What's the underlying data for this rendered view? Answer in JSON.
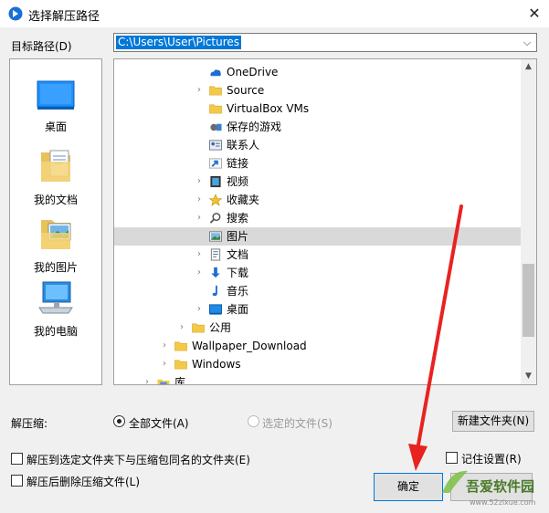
{
  "window": {
    "title": "选择解压路径"
  },
  "target": {
    "label": "目标路径(D)",
    "path": "C:\\Users\\User\\Pictures"
  },
  "places": [
    {
      "label": "桌面",
      "icon": "desktop-icon"
    },
    {
      "label": "我的文档",
      "icon": "documents-icon"
    },
    {
      "label": "我的图片",
      "icon": "pictures-icon"
    },
    {
      "label": "我的电脑",
      "icon": "computer-icon"
    }
  ],
  "tree": [
    {
      "label": "OneDrive",
      "icon": "onedrive-icon",
      "level": 3,
      "expander": false,
      "selected": false
    },
    {
      "label": "Source",
      "icon": "folder-icon",
      "level": 3,
      "expander": true,
      "selected": false
    },
    {
      "label": "VirtualBox VMs",
      "icon": "folder-icon",
      "level": 3,
      "expander": false,
      "selected": false
    },
    {
      "label": "保存的游戏",
      "icon": "saved-games-icon",
      "level": 3,
      "expander": false,
      "selected": false
    },
    {
      "label": "联系人",
      "icon": "contacts-icon",
      "level": 3,
      "expander": false,
      "selected": false
    },
    {
      "label": "链接",
      "icon": "links-icon",
      "level": 3,
      "expander": false,
      "selected": false
    },
    {
      "label": "视频",
      "icon": "videos-icon",
      "level": 3,
      "expander": true,
      "selected": false
    },
    {
      "label": "收藏夹",
      "icon": "favorites-icon",
      "level": 3,
      "expander": true,
      "selected": false
    },
    {
      "label": "搜索",
      "icon": "search-icon",
      "level": 3,
      "expander": true,
      "selected": false
    },
    {
      "label": "图片",
      "icon": "pictures-icon",
      "level": 3,
      "expander": false,
      "selected": true
    },
    {
      "label": "文档",
      "icon": "documents-icon",
      "level": 3,
      "expander": true,
      "selected": false
    },
    {
      "label": "下载",
      "icon": "downloads-icon",
      "level": 3,
      "expander": true,
      "selected": false
    },
    {
      "label": "音乐",
      "icon": "music-icon",
      "level": 3,
      "expander": false,
      "selected": false
    },
    {
      "label": "桌面",
      "icon": "desktop-icon",
      "level": 3,
      "expander": true,
      "selected": false
    },
    {
      "label": "公用",
      "icon": "folder-icon",
      "level": 2,
      "expander": true,
      "selected": false
    },
    {
      "label": "Wallpaper_Download",
      "icon": "folder-icon",
      "level": 1,
      "expander": true,
      "selected": false
    },
    {
      "label": "Windows",
      "icon": "folder-icon",
      "level": 1,
      "expander": true,
      "selected": false
    },
    {
      "label": "库",
      "icon": "library-icon",
      "level": 0,
      "expander": true,
      "selected": false
    }
  ],
  "extract": {
    "label": "解压缩:",
    "all_files": "全部文件(A)",
    "selected_files": "选定的文件(S)",
    "new_folder": "新建文件夹(N)"
  },
  "options": {
    "extract_to_same_name": "解压到选定文件夹下与压缩包同名的文件夹(E)",
    "delete_after": "解压后删除压缩文件(L)",
    "remember": "记住设置(R)"
  },
  "buttons": {
    "ok": "确定"
  },
  "watermark": {
    "brand": "吾爱软件园",
    "url": "www.52zixue.com"
  },
  "colors": {
    "selection": "#0078d7",
    "tree_selected": "#d9d9d9",
    "arrow": "#e8231f"
  }
}
